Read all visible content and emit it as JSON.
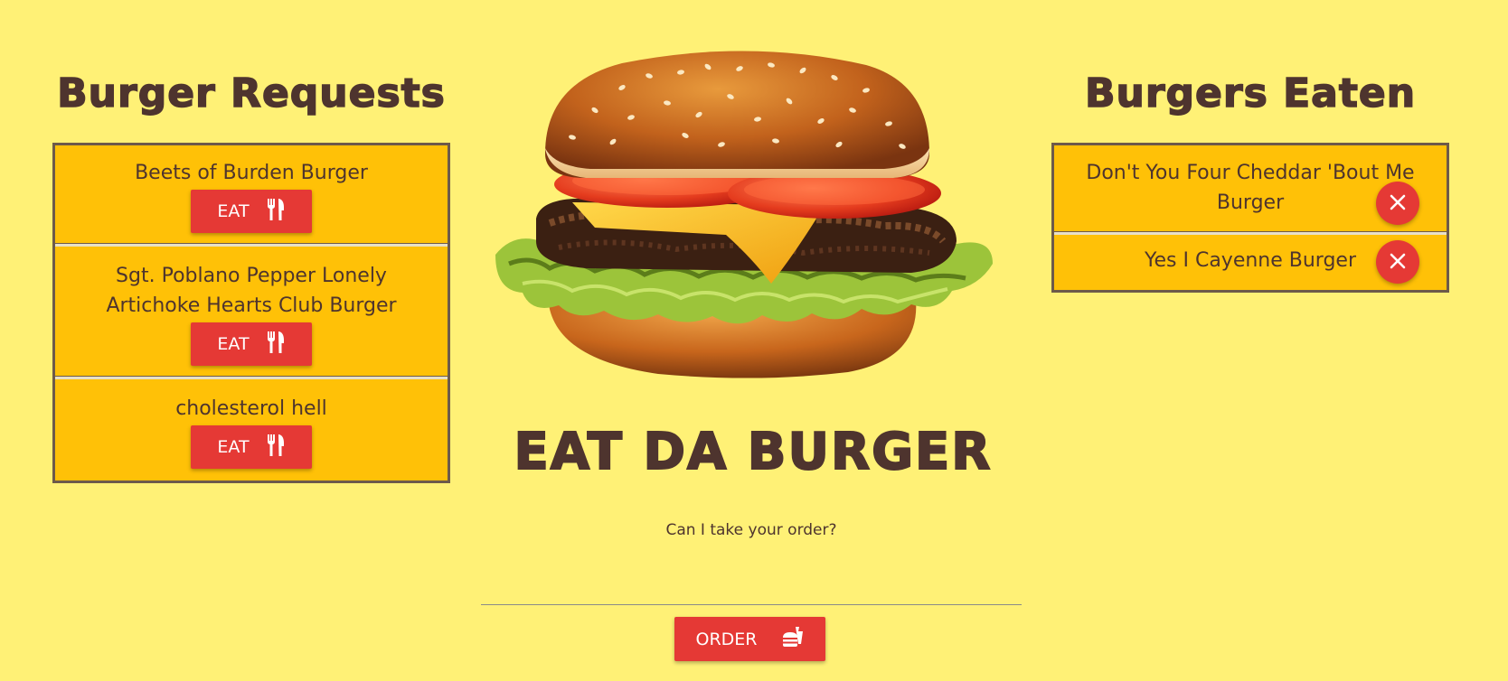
{
  "requests": {
    "title": "Burger Requests",
    "eat_label": "EAT",
    "items": [
      {
        "name": "Beets of Burden Burger"
      },
      {
        "name": "Sgt. Poblano Pepper Lonely Artichoke Hearts Club Burger"
      },
      {
        "name": "cholesterol hell"
      }
    ]
  },
  "eaten": {
    "title": "Burgers Eaten",
    "items": [
      {
        "name": "Don't You Four Cheddar 'Bout Me Burger"
      },
      {
        "name": "Yes I Cayenne Burger"
      }
    ]
  },
  "main": {
    "title": "EAT DA BURGER",
    "order_prompt": "Can I take your order?",
    "order_input_value": "",
    "order_button": "ORDER"
  },
  "colors": {
    "background": "#fff176",
    "panel": "#ffc107",
    "button": "#e53935",
    "text": "#4e342e"
  },
  "icons": {
    "eat": "utensils-icon",
    "delete": "close-icon",
    "order": "fastfood-icon"
  }
}
